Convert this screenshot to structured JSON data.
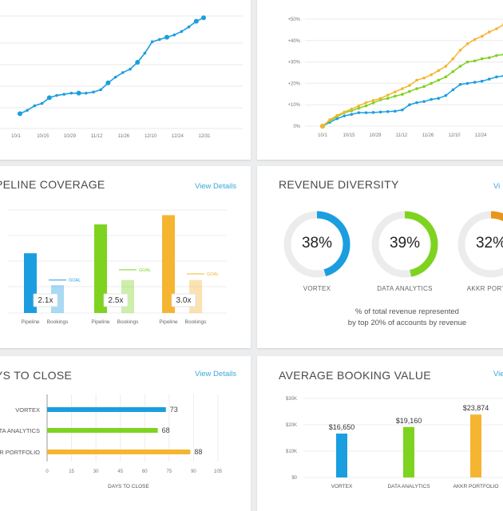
{
  "colors": {
    "vortex": "#1a9ee0",
    "data_analytics": "#7ed321",
    "akkr": "#f5b531",
    "akkr_dark": "#e8951c",
    "link": "#3aa7dd",
    "track": "#ececec"
  },
  "top_left": {
    "chart_data": {
      "type": "line",
      "x_ticks": [
        "10/1",
        "10/15",
        "10/29",
        "11/12",
        "11/26",
        "12/10",
        "12/24",
        "12/31"
      ],
      "series": [
        {
          "values": [
            0.13,
            0.16,
            0.2,
            0.22,
            0.27,
            0.29,
            0.3,
            0.31,
            0.31,
            0.31,
            0.32,
            0.34,
            0.4,
            0.45,
            0.49,
            0.52,
            0.58,
            0.66,
            0.76,
            0.78,
            0.8,
            0.82,
            0.85,
            0.89,
            0.94,
            0.97
          ]
        }
      ]
    }
  },
  "top_right": {
    "chart_data": {
      "type": "line",
      "y_ticks": [
        "0%",
        "+10%",
        "+20%",
        "+30%",
        "+40%",
        "+50%",
        "+60%"
      ],
      "x_ticks": [
        "10/1",
        "10/15",
        "10/29",
        "11/12",
        "11/26",
        "12/10",
        "12/24"
      ],
      "series": [
        {
          "color_key": "vortex",
          "values": [
            0,
            1.8,
            3.5,
            4.8,
            5.5,
            6.3,
            6.3,
            6.4,
            6.6,
            6.8,
            7.0,
            7.6,
            10.0,
            11.0,
            11.5,
            12.5,
            13.0,
            14.3,
            17.0,
            19.5,
            20.0,
            20.5,
            21.0,
            22.0,
            23.0,
            23.5,
            24.5
          ]
        },
        {
          "color_key": "data_analytics",
          "values": [
            0,
            2.5,
            4.5,
            6.3,
            7.2,
            8.4,
            9.5,
            10.9,
            12.3,
            13.0,
            14.0,
            14.9,
            16.2,
            17.5,
            18.5,
            20.0,
            21.5,
            23.0,
            25.5,
            28.0,
            30.0,
            30.5,
            31.5,
            32.0,
            33.0,
            33.5,
            34.0
          ]
        },
        {
          "color_key": "akkr",
          "values": [
            0,
            3.0,
            5.0,
            6.6,
            8.0,
            9.5,
            11.0,
            12.0,
            13.0,
            14.5,
            16.0,
            17.5,
            19.0,
            21.5,
            22.5,
            24.0,
            26.0,
            28.0,
            31.5,
            35.5,
            38.5,
            40.5,
            42.0,
            44.0,
            45.5,
            47.5,
            49.0
          ]
        }
      ]
    }
  },
  "pipeline": {
    "title": "PELINE COVERAGE",
    "view_details": "View Details",
    "chart_data": {
      "type": "bar",
      "groups": [
        {
          "color_key": "vortex",
          "pipeline": 0.58,
          "bookings": 0.27,
          "goal": 0.32,
          "ratio": "2.1x",
          "pipeline_label": "Pipeline",
          "bookings_label": "Bookings",
          "goal_label": "GOAL"
        },
        {
          "color_key": "data_analytics",
          "pipeline": 0.86,
          "bookings": 0.32,
          "goal": 0.42,
          "ratio": "2.5x",
          "pipeline_label": "Pipeline",
          "bookings_label": "Bookings",
          "goal_label": "GOAL"
        },
        {
          "color_key": "akkr",
          "pipeline": 0.95,
          "bookings": 0.32,
          "goal": 0.38,
          "ratio": "3.0x",
          "pipeline_label": "Pipeline",
          "bookings_label": "Bookings",
          "goal_label": "GOAL"
        }
      ]
    }
  },
  "diversity": {
    "title": "REVENUE DIVERSITY",
    "view_details": "Vi",
    "caption_line1": "% of total revenue represented",
    "caption_line2": "by top 20% of accounts by revenue",
    "donuts": [
      {
        "value": 38,
        "label_text": "38%",
        "name": "VORTEX",
        "color_key": "vortex"
      },
      {
        "value": 39,
        "label_text": "39%",
        "name": "DATA ANALYTICS",
        "color_key": "data_analytics"
      },
      {
        "value": 32,
        "label_text": "32%",
        "name": "AKKR PORTFO",
        "color_key": "akkr_dark"
      }
    ]
  },
  "days_to_close": {
    "title": "YS TO CLOSE",
    "view_details": "View Details",
    "chart_data": {
      "type": "bar",
      "orientation": "horizontal",
      "xlabel": "DAYS TO CLOSE",
      "x_ticks": [
        0,
        15,
        30,
        45,
        60,
        75,
        90,
        105
      ],
      "xlim": [
        0,
        105
      ],
      "bars": [
        {
          "category": "VORTEX",
          "value": 73,
          "value_label": "73",
          "color_key": "vortex"
        },
        {
          "category": "DATA ANALYTICS",
          "value": 68,
          "value_label": "68",
          "color_key": "data_analytics"
        },
        {
          "category": "R PORTFOLIO",
          "value": 88,
          "value_label": "88",
          "color_key": "akkr"
        }
      ]
    }
  },
  "avg_booking": {
    "title": "AVERAGE BOOKING VALUE",
    "view_details": "Vie",
    "chart_data": {
      "type": "bar",
      "y_ticks": [
        "$0",
        "$10K",
        "$20K",
        "$30K"
      ],
      "ylim": [
        0,
        30000
      ],
      "bars": [
        {
          "category": "VORTEX",
          "value": 16650,
          "value_label": "$16,650",
          "color_key": "vortex"
        },
        {
          "category": "DATA ANALYTICS",
          "value": 19160,
          "value_label": "$19,160",
          "color_key": "data_analytics"
        },
        {
          "category": "AKKR PORTFOLIO",
          "value": 23874,
          "value_label": "$23,874",
          "color_key": "akkr"
        }
      ]
    }
  }
}
